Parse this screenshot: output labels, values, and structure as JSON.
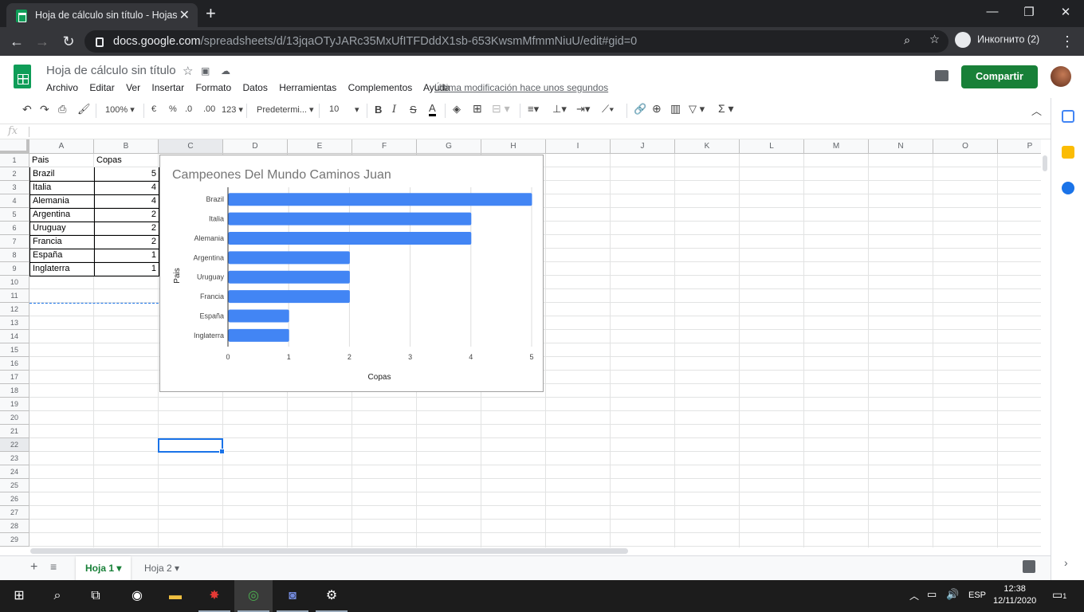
{
  "browser": {
    "tab_title": "Hoja de cálculo sin título - Hojas",
    "url_domain": "docs.google.com",
    "url_path": "/spreadsheets/d/13jqaOTyJARc35MxUfITFDddX1sb-653KwsmMfmmNiuU/edit#gid=0",
    "profile_label": "Инкогнито (2)"
  },
  "doc": {
    "title": "Hoja de cálculo sin título",
    "menus": [
      "Archivo",
      "Editar",
      "Ver",
      "Insertar",
      "Formato",
      "Datos",
      "Herramientas",
      "Complementos",
      "Ayuda"
    ],
    "last_modified": "Última modificación hace unos segundos",
    "share_label": "Compartir"
  },
  "toolbar": {
    "zoom": "100%",
    "currency": "€",
    "percent": "%",
    "dec_less": ".0",
    "dec_more": ".00",
    "format_more": "123",
    "font": "Predetermi...",
    "font_size": "10"
  },
  "formula": {
    "fx": "fx"
  },
  "columns": [
    "A",
    "B",
    "C",
    "D",
    "E",
    "F",
    "G",
    "H",
    "I",
    "J",
    "K",
    "L",
    "M",
    "N",
    "O",
    "P"
  ],
  "rows": [
    "1",
    "2",
    "3",
    "4",
    "5",
    "6",
    "7",
    "8",
    "9",
    "10",
    "11",
    "12",
    "13",
    "14",
    "15",
    "16",
    "17",
    "18",
    "19",
    "20",
    "21",
    "22",
    "23",
    "24",
    "25",
    "26",
    "27",
    "28",
    "29"
  ],
  "table": {
    "headers": [
      "Pais",
      "Copas"
    ],
    "rows": [
      [
        "Brazil",
        "5"
      ],
      [
        "Italia",
        "4"
      ],
      [
        "Alemania",
        "4"
      ],
      [
        "Argentina",
        "2"
      ],
      [
        "Uruguay",
        "2"
      ],
      [
        "Francia",
        "2"
      ],
      [
        "España",
        "1"
      ],
      [
        "Inglaterra",
        "1"
      ]
    ]
  },
  "chart_data": {
    "type": "bar",
    "orientation": "horizontal",
    "title": "Campeones Del Mundo Caminos Juan",
    "categories": [
      "Brazil",
      "Italia",
      "Alemania",
      "Argentina",
      "Uruguay",
      "Francia",
      "España",
      "Inglaterra"
    ],
    "values": [
      5,
      4,
      4,
      2,
      2,
      2,
      1,
      1
    ],
    "xlabel": "Copas",
    "ylabel": "Pais",
    "xlim": [
      0,
      5
    ],
    "xticks": [
      "0",
      "1",
      "2",
      "3",
      "4",
      "5"
    ],
    "bar_color": "#4285f4",
    "grid": true
  },
  "sheets": [
    "Hoja 1",
    "Hoja 2"
  ],
  "taskbar": {
    "lang": "ESP",
    "time": "12:38",
    "date": "12/11/2020",
    "notification_count": "1"
  },
  "colors": {
    "accent": "#188038",
    "selection": "#1a73e8"
  }
}
